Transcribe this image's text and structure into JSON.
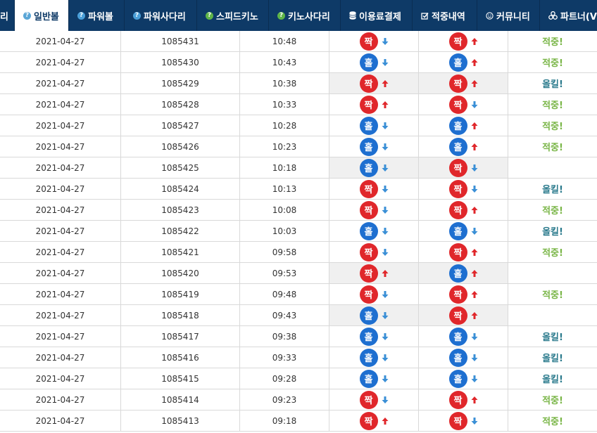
{
  "nav": [
    {
      "label": "리",
      "icon": "none",
      "active": false
    },
    {
      "label": "일반볼",
      "icon": "question-icon",
      "iconColor": "#5aa6d6",
      "active": true
    },
    {
      "label": "파워볼",
      "icon": "question-icon",
      "iconColor": "#4a9fd8",
      "active": false
    },
    {
      "label": "파워사다리",
      "icon": "question-icon",
      "iconColor": "#4a9fd8",
      "active": false
    },
    {
      "label": "스피드키노",
      "icon": "question-icon",
      "iconColor": "#5fb548",
      "active": false
    },
    {
      "label": "키노사다리",
      "icon": "question-icon",
      "iconColor": "#5fb548",
      "active": false
    },
    {
      "label": "이용료결제",
      "icon": "database-icon",
      "iconColor": "#ffffff",
      "active": false
    },
    {
      "label": "적중내역",
      "icon": "checkbox-icon",
      "iconColor": "#ffffff",
      "active": false
    },
    {
      "label": "커뮤니티",
      "icon": "smiley-icon",
      "iconColor": "#ffffff",
      "active": false
    },
    {
      "label": "파트너(V",
      "icon": "partners-icon",
      "iconColor": "#ffffff",
      "active": false
    }
  ],
  "colors": {
    "nav_bg": "#0e3a67",
    "red_ball": "#e0272b",
    "blue_ball": "#1e6fd0",
    "arrow_up": "#e0272b",
    "arrow_down": "#3a8fd6",
    "hit": "#7ab648",
    "miss": "#2a7a8c"
  },
  "rows": [
    {
      "date": "2021-04-27",
      "round": "1085431",
      "time": "10:48",
      "r1": "짝",
      "r1c": "red",
      "a1": "down",
      "r2": "짝",
      "r2c": "red",
      "a2": "up",
      "result": "적중!",
      "rt": "hit",
      "shade": false
    },
    {
      "date": "2021-04-27",
      "round": "1085430",
      "time": "10:43",
      "r1": "홀",
      "r1c": "blue",
      "a1": "down",
      "r2": "홀",
      "r2c": "blue",
      "a2": "up",
      "result": "적중!",
      "rt": "hit",
      "shade": false
    },
    {
      "date": "2021-04-27",
      "round": "1085429",
      "time": "10:38",
      "r1": "짝",
      "r1c": "red",
      "a1": "up",
      "r2": "짝",
      "r2c": "red",
      "a2": "up",
      "result": "올킬!",
      "rt": "miss",
      "shade": true
    },
    {
      "date": "2021-04-27",
      "round": "1085428",
      "time": "10:33",
      "r1": "짝",
      "r1c": "red",
      "a1": "up",
      "r2": "짝",
      "r2c": "red",
      "a2": "down",
      "result": "적중!",
      "rt": "hit",
      "shade": false
    },
    {
      "date": "2021-04-27",
      "round": "1085427",
      "time": "10:28",
      "r1": "홀",
      "r1c": "blue",
      "a1": "down",
      "r2": "홀",
      "r2c": "blue",
      "a2": "up",
      "result": "적중!",
      "rt": "hit",
      "shade": false
    },
    {
      "date": "2021-04-27",
      "round": "1085426",
      "time": "10:23",
      "r1": "홀",
      "r1c": "blue",
      "a1": "down",
      "r2": "홀",
      "r2c": "blue",
      "a2": "up",
      "result": "적중!",
      "rt": "hit",
      "shade": false
    },
    {
      "date": "2021-04-27",
      "round": "1085425",
      "time": "10:18",
      "r1": "홀",
      "r1c": "blue",
      "a1": "down",
      "r2": "짝",
      "r2c": "red",
      "a2": "down",
      "result": "",
      "rt": "none",
      "shade": true
    },
    {
      "date": "2021-04-27",
      "round": "1085424",
      "time": "10:13",
      "r1": "짝",
      "r1c": "red",
      "a1": "down",
      "r2": "짝",
      "r2c": "red",
      "a2": "down",
      "result": "올킬!",
      "rt": "miss",
      "shade": false
    },
    {
      "date": "2021-04-27",
      "round": "1085423",
      "time": "10:08",
      "r1": "짝",
      "r1c": "red",
      "a1": "down",
      "r2": "짝",
      "r2c": "red",
      "a2": "up",
      "result": "적중!",
      "rt": "hit",
      "shade": false
    },
    {
      "date": "2021-04-27",
      "round": "1085422",
      "time": "10:03",
      "r1": "홀",
      "r1c": "blue",
      "a1": "down",
      "r2": "홀",
      "r2c": "blue",
      "a2": "down",
      "result": "올킬!",
      "rt": "miss",
      "shade": false
    },
    {
      "date": "2021-04-27",
      "round": "1085421",
      "time": "09:58",
      "r1": "짝",
      "r1c": "red",
      "a1": "down",
      "r2": "짝",
      "r2c": "red",
      "a2": "up",
      "result": "적중!",
      "rt": "hit",
      "shade": false
    },
    {
      "date": "2021-04-27",
      "round": "1085420",
      "time": "09:53",
      "r1": "짝",
      "r1c": "red",
      "a1": "up",
      "r2": "홀",
      "r2c": "blue",
      "a2": "up",
      "result": "",
      "rt": "none",
      "shade": true
    },
    {
      "date": "2021-04-27",
      "round": "1085419",
      "time": "09:48",
      "r1": "짝",
      "r1c": "red",
      "a1": "down",
      "r2": "짝",
      "r2c": "red",
      "a2": "up",
      "result": "적중!",
      "rt": "hit",
      "shade": false
    },
    {
      "date": "2021-04-27",
      "round": "1085418",
      "time": "09:43",
      "r1": "홀",
      "r1c": "blue",
      "a1": "down",
      "r2": "짝",
      "r2c": "red",
      "a2": "up",
      "result": "",
      "rt": "none",
      "shade": true
    },
    {
      "date": "2021-04-27",
      "round": "1085417",
      "time": "09:38",
      "r1": "홀",
      "r1c": "blue",
      "a1": "down",
      "r2": "홀",
      "r2c": "blue",
      "a2": "down",
      "result": "올킬!",
      "rt": "miss",
      "shade": false
    },
    {
      "date": "2021-04-27",
      "round": "1085416",
      "time": "09:33",
      "r1": "홀",
      "r1c": "blue",
      "a1": "down",
      "r2": "홀",
      "r2c": "blue",
      "a2": "down",
      "result": "올킬!",
      "rt": "miss",
      "shade": false
    },
    {
      "date": "2021-04-27",
      "round": "1085415",
      "time": "09:28",
      "r1": "홀",
      "r1c": "blue",
      "a1": "down",
      "r2": "홀",
      "r2c": "blue",
      "a2": "down",
      "result": "올킬!",
      "rt": "miss",
      "shade": false
    },
    {
      "date": "2021-04-27",
      "round": "1085414",
      "time": "09:23",
      "r1": "짝",
      "r1c": "red",
      "a1": "down",
      "r2": "짝",
      "r2c": "red",
      "a2": "up",
      "result": "적중!",
      "rt": "hit",
      "shade": false
    },
    {
      "date": "2021-04-27",
      "round": "1085413",
      "time": "09:18",
      "r1": "짝",
      "r1c": "red",
      "a1": "up",
      "r2": "짝",
      "r2c": "red",
      "a2": "down",
      "result": "적중!",
      "rt": "hit",
      "shade": false
    }
  ]
}
